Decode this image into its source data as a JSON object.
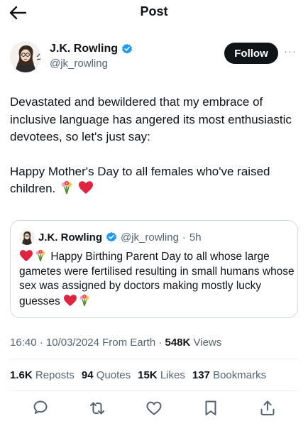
{
  "header": {
    "title": "Post"
  },
  "author": {
    "name": "J.K. Rowling",
    "handle": "@jk_rowling",
    "follow_label": "Follow",
    "more": "···"
  },
  "tweet": {
    "paragraph1": "Devastated and bewildered that my embrace of inclusive language has angered its most enthusiastic devotees, so let's just say:",
    "paragraph2": "Happy Mother's Day to all females who've raised children."
  },
  "quote": {
    "name": "J.K. Rowling",
    "handle": "@jk_rowling",
    "separator": "·",
    "time": "5h",
    "text": "Happy Birthing Parent Day to all whose large gametes were fertilised resulting in small humans whose sex was assigned by doctors making mostly lucky guesses"
  },
  "meta": {
    "time": "16:40",
    "dot1": "·",
    "date": "10/03/2024",
    "source": "From Earth",
    "dot2": "·",
    "views_count": "548K",
    "views_label": "Views"
  },
  "stats": {
    "reposts_count": "1.6K",
    "reposts_label": "Reposts",
    "quotes_count": "94",
    "quotes_label": "Quotes",
    "likes_count": "15K",
    "likes_label": "Likes",
    "bookmarks_count": "137",
    "bookmarks_label": "Bookmarks"
  },
  "icons": {
    "back": "arrow-left-icon",
    "verified": "verified-badge-icon",
    "reply": "reply-icon",
    "repost": "repost-icon",
    "like": "heart-icon",
    "bookmark": "bookmark-icon",
    "share": "share-icon",
    "heart_emoji": "red-heart-emoji",
    "bouquet_emoji": "bouquet-emoji"
  },
  "colors": {
    "verified": "#1d9bf0",
    "text": "#0f1419",
    "secondary": "#536471",
    "heart": "#e0245e"
  }
}
